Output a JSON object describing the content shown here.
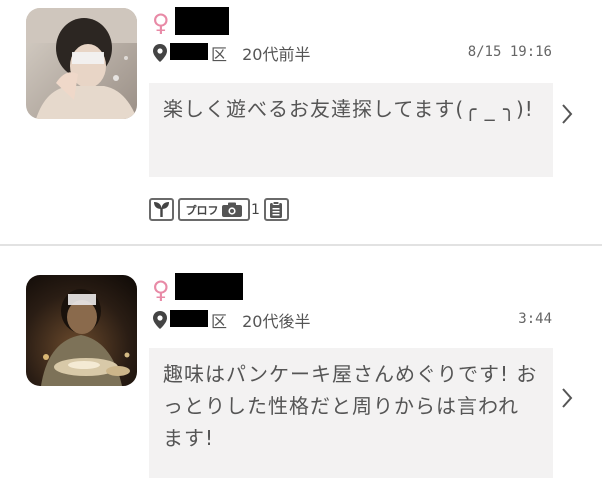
{
  "colors": {
    "gender_pink": "#e88aa6",
    "bubble_bg": "#f3f2f2",
    "text": "#555555"
  },
  "posts": [
    {
      "gender_symbol": "♀",
      "name_redacted": true,
      "area_suffix": "区",
      "age": "20代前半",
      "time": "8/15 19:16",
      "message": "楽しく遊べるお友達探してます(╭ _ ╮)!",
      "badges": {
        "sprout_icon": "sprout-icon",
        "profile_label": "プロフ",
        "photo_count": "1",
        "memo_icon": "memo-icon"
      }
    },
    {
      "gender_symbol": "♀",
      "name_redacted": true,
      "area_suffix": "区",
      "age": "20代後半",
      "time": "3:44",
      "message": "趣味はパンケーキ屋さんめぐりです! おっとりした性格だと周りからは言われます!"
    }
  ]
}
